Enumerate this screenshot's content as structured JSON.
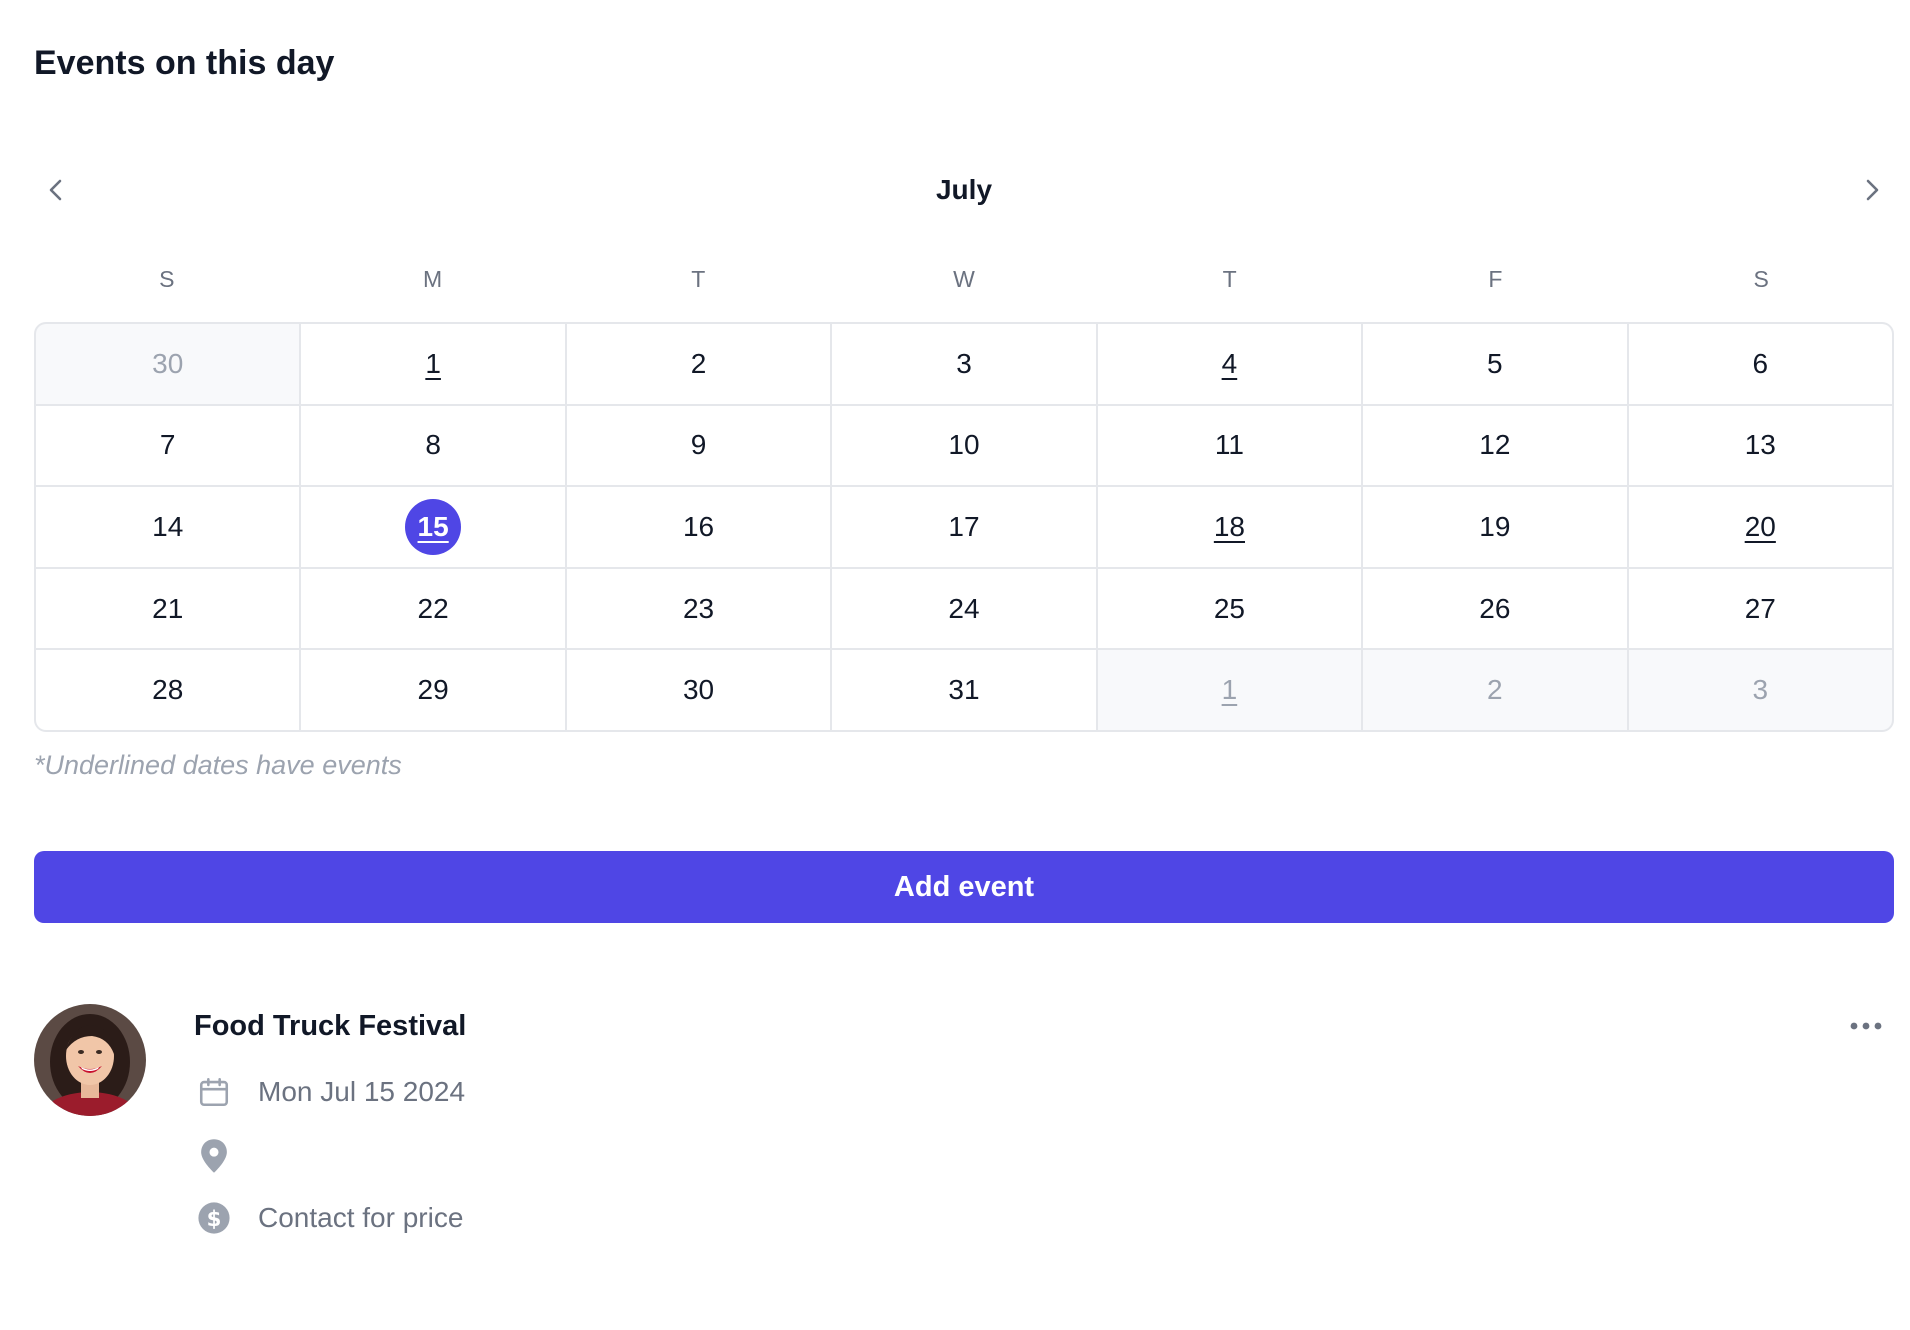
{
  "header": {
    "title": "Events on this day"
  },
  "calendar": {
    "month": "July",
    "prev_icon": "chevron-left-icon",
    "next_icon": "chevron-right-icon",
    "weekdays": [
      "S",
      "M",
      "T",
      "W",
      "T",
      "F",
      "S"
    ],
    "weeks": [
      [
        {
          "day": "30",
          "other": true
        },
        {
          "day": "1",
          "events": true
        },
        {
          "day": "2"
        },
        {
          "day": "3"
        },
        {
          "day": "4",
          "events": true
        },
        {
          "day": "5"
        },
        {
          "day": "6"
        }
      ],
      [
        {
          "day": "7"
        },
        {
          "day": "8"
        },
        {
          "day": "9"
        },
        {
          "day": "10"
        },
        {
          "day": "11"
        },
        {
          "day": "12"
        },
        {
          "day": "13"
        }
      ],
      [
        {
          "day": "14"
        },
        {
          "day": "15",
          "events": true,
          "selected": true
        },
        {
          "day": "16"
        },
        {
          "day": "17"
        },
        {
          "day": "18",
          "events": true
        },
        {
          "day": "19"
        },
        {
          "day": "20",
          "events": true
        }
      ],
      [
        {
          "day": "21"
        },
        {
          "day": "22"
        },
        {
          "day": "23"
        },
        {
          "day": "24"
        },
        {
          "day": "25"
        },
        {
          "day": "26"
        },
        {
          "day": "27"
        }
      ],
      [
        {
          "day": "28"
        },
        {
          "day": "29"
        },
        {
          "day": "30"
        },
        {
          "day": "31"
        },
        {
          "day": "1",
          "other": true,
          "events": true
        },
        {
          "day": "2",
          "other": true
        },
        {
          "day": "3",
          "other": true
        }
      ]
    ],
    "note": "*Underlined dates have events",
    "accent_color": "#4f46e5"
  },
  "actions": {
    "add_event_label": "Add event"
  },
  "event": {
    "title": "Food Truck Festival",
    "date": "Mon Jul 15 2024",
    "location": "",
    "price": "Contact for price",
    "avatar_icon": "avatar",
    "date_icon": "calendar-icon",
    "location_icon": "map-pin-icon",
    "price_icon": "dollar-icon",
    "menu_icon": "more-horizontal-icon"
  }
}
